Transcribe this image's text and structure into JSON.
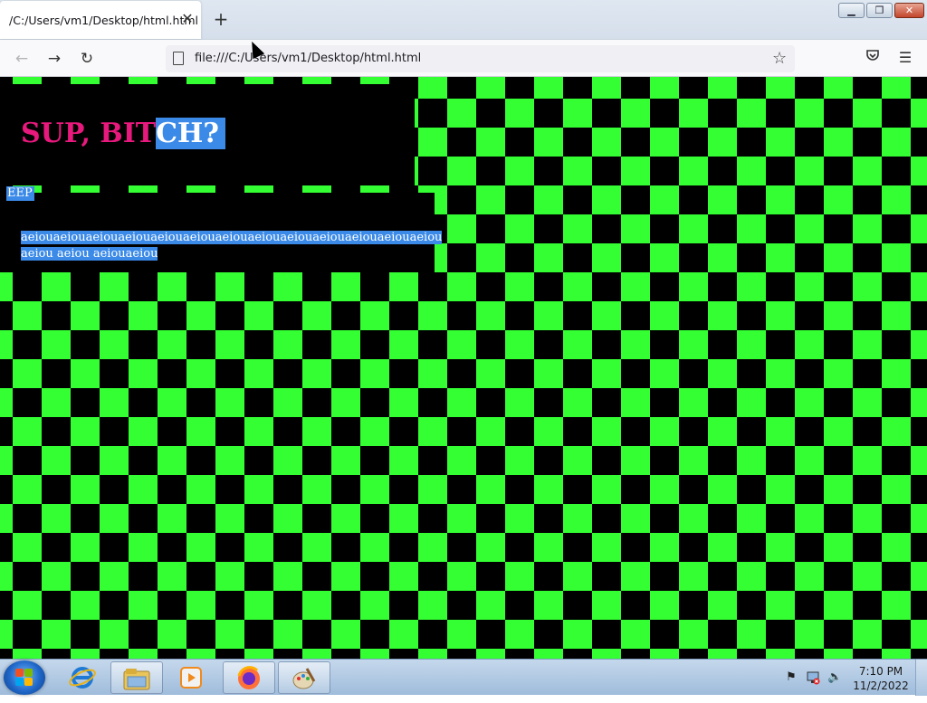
{
  "browser": {
    "tab": {
      "title": "/C:/Users/vm1/Desktop/html.html",
      "close_icon": "close-icon"
    },
    "new_tab_icon": "plus-icon",
    "window_controls": {
      "minimize": "minimize-icon",
      "maximize": "restore-icon",
      "close": "close-icon"
    },
    "nav": {
      "back_icon": "arrow-left-icon",
      "forward_icon": "arrow-right-icon",
      "reload_icon": "reload-icon",
      "url": "file:///C:/Users/vm1/Desktop/html.html",
      "page_icon": "file-icon",
      "bookmark_icon": "star-icon",
      "pocket_icon": "pocket-icon",
      "menu_icon": "hamburger-menu-icon"
    }
  },
  "page": {
    "heading_unselected": "SUP, BIT",
    "heading_selected": "CH?",
    "eep": "EEP",
    "paragraph": "aeiouaeiouaeiouaeiouaeiouaeiouaeiouaeiouaeiouaeiouaeiouaeiouaeiou aeiou aeiou aeiouaeiou",
    "colors": {
      "heading": "#e8197d",
      "selection": "#3b8ae8",
      "checker_green": "#33ff33",
      "checker_black": "#000000"
    }
  },
  "taskbar": {
    "start_icon": "windows-start-icon",
    "apps": [
      {
        "name": "Internet Explorer",
        "icon": "internet-explorer-icon"
      },
      {
        "name": "Windows Explorer",
        "icon": "folder-icon"
      },
      {
        "name": "Windows Media Player",
        "icon": "media-player-icon"
      },
      {
        "name": "Firefox",
        "icon": "firefox-icon"
      },
      {
        "name": "Paint",
        "icon": "paint-icon"
      }
    ],
    "tray": {
      "time": "7:10 PM",
      "date": "11/2/2022"
    }
  }
}
